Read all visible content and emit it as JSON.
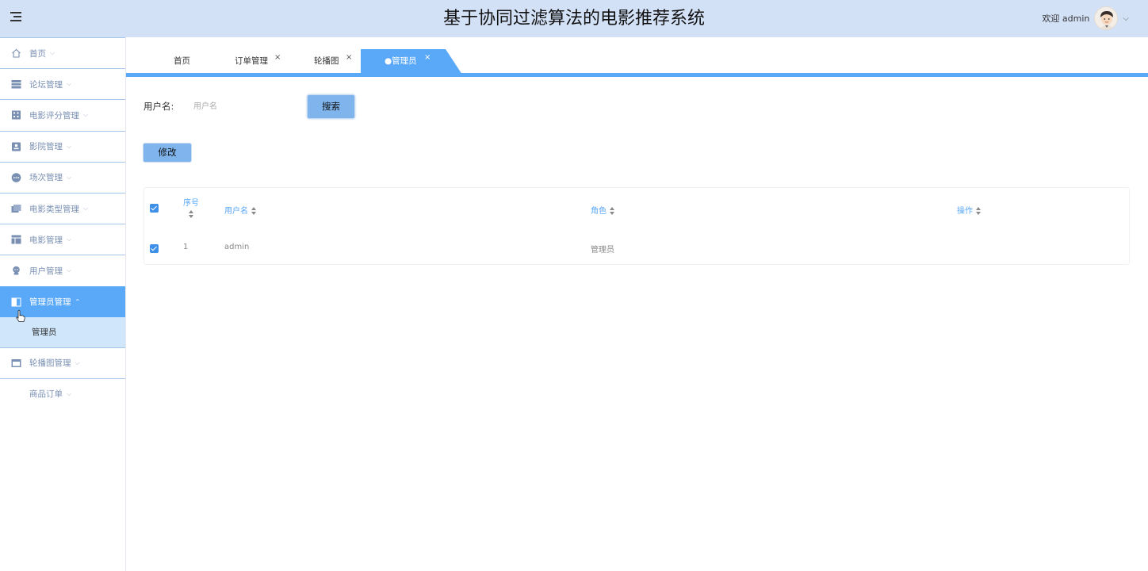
{
  "header": {
    "title": "基于协同过滤算法的电影推荐系统",
    "welcome": "欢迎 admin",
    "menu_icon": "hamburger-icon",
    "avatar_icon": "user-avatar",
    "user_caret": "⌵"
  },
  "sidebar": {
    "items": [
      {
        "label": "首页",
        "icon": "home-icon",
        "caret": "⌵"
      },
      {
        "label": "论坛管理",
        "icon": "list-icon",
        "caret": "⌵"
      },
      {
        "label": "电影评分管理",
        "icon": "grid-icon",
        "caret": "⌵"
      },
      {
        "label": "影院管理",
        "icon": "contact-icon",
        "caret": "⌵"
      },
      {
        "label": "场次管理",
        "icon": "dots-icon",
        "caret": "⌵"
      },
      {
        "label": "电影类型管理",
        "icon": "folders-icon",
        "caret": "⌵"
      },
      {
        "label": "电影管理",
        "icon": "layout-icon",
        "caret": "⌵"
      },
      {
        "label": "用户管理",
        "icon": "user-icon",
        "caret": "⌵"
      },
      {
        "label": "管理员管理",
        "icon": "book-icon",
        "caret": "⌃"
      },
      {
        "label": "轮播图管理",
        "icon": "banner-icon",
        "caret": "⌵"
      },
      {
        "label": "商品订单",
        "icon": "",
        "caret": "⌵"
      }
    ],
    "submenu": {
      "label": "管理员"
    }
  },
  "tabs": [
    {
      "label": "首页",
      "close": ""
    },
    {
      "label": "订单管理",
      "close": "×"
    },
    {
      "label": "轮播图",
      "close": "×"
    },
    {
      "label": "●管理员",
      "close": "×",
      "active": true
    }
  ],
  "search": {
    "label": "用户名:",
    "placeholder": "用户名",
    "button": "搜索"
  },
  "actions": {
    "edit": "修改"
  },
  "table": {
    "columns": [
      "序号",
      "用户名",
      "角色",
      "操作"
    ],
    "rows": [
      {
        "index": "1",
        "username": "admin",
        "role": "管理员",
        "ops": ""
      }
    ]
  },
  "colors": {
    "header_bg": "#d3e1f7",
    "accent": "#5aa8f8",
    "submenu_bg": "#cfe6fb",
    "button_bg": "#7fb4ec"
  }
}
